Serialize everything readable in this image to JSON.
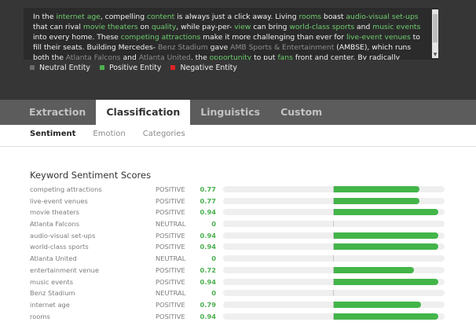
{
  "input_text": {
    "segments": [
      {
        "t": "In the ",
        "c": "plain"
      },
      {
        "t": "internet age",
        "c": "pos"
      },
      {
        "t": ", compelling ",
        "c": "plain"
      },
      {
        "t": "content",
        "c": "pos"
      },
      {
        "t": " is always just a click away. Living ",
        "c": "plain"
      },
      {
        "t": "rooms",
        "c": "pos"
      },
      {
        "t": " boast ",
        "c": "plain"
      },
      {
        "t": "audio-visual set-ups",
        "c": "pos"
      },
      {
        "t": " that can rival ",
        "c": "plain"
      },
      {
        "t": "movie theaters",
        "c": "pos"
      },
      {
        "t": " on ",
        "c": "plain"
      },
      {
        "t": "quality",
        "c": "pos"
      },
      {
        "t": ", while pay-per- ",
        "c": "plain"
      },
      {
        "t": "view",
        "c": "pos"
      },
      {
        "t": " can bring ",
        "c": "plain"
      },
      {
        "t": "world-class sports",
        "c": "pos"
      },
      {
        "t": " and ",
        "c": "plain"
      },
      {
        "t": "music events",
        "c": "pos"
      },
      {
        "t": " into every home. These ",
        "c": "plain"
      },
      {
        "t": "competing attractions",
        "c": "pos"
      },
      {
        "t": " make it more challenging than ever for ",
        "c": "plain"
      },
      {
        "t": "live-event venues",
        "c": "pos"
      },
      {
        "t": " to fill their seats. Building Mercedes- ",
        "c": "plain"
      },
      {
        "t": "Benz Stadium",
        "c": "neu"
      },
      {
        "t": " gave ",
        "c": "plain"
      },
      {
        "t": "AMB Sports & Entertainment",
        "c": "neu"
      },
      {
        "t": " (AMBSE), which runs both the ",
        "c": "plain"
      },
      {
        "t": "Atlanta Falcons",
        "c": "neu"
      },
      {
        "t": " and ",
        "c": "plain"
      },
      {
        "t": "Atlanta United",
        "c": "neu"
      },
      {
        "t": ", the ",
        "c": "plain"
      },
      {
        "t": "opportunity",
        "c": "pos"
      },
      {
        "t": " to put ",
        "c": "plain"
      },
      {
        "t": "fans",
        "c": "pos"
      },
      {
        "t": " front and center. By radically reimagining what a sports and",
        "c": "plain"
      }
    ]
  },
  "legend": [
    {
      "label": "Neutral Entity",
      "color": "#6a6a6a"
    },
    {
      "label": "Positive Entity",
      "color": "#4caf50"
    },
    {
      "label": "Negative Entity",
      "color": "#e02424"
    }
  ],
  "tabs": [
    {
      "label": "Extraction",
      "active": false
    },
    {
      "label": "Classification",
      "active": true
    },
    {
      "label": "Linguistics",
      "active": false
    },
    {
      "label": "Custom",
      "active": false
    }
  ],
  "subtabs": [
    {
      "label": "Sentiment",
      "active": true
    },
    {
      "label": "Emotion",
      "active": false
    },
    {
      "label": "Categories",
      "active": false
    }
  ],
  "keyword_section": {
    "title": "Keyword Sentiment Scores"
  },
  "keywords": [
    {
      "keyword": "competing attractions",
      "sentiment": "POSITIVE",
      "score": 0.77
    },
    {
      "keyword": "live-event venues",
      "sentiment": "POSITIVE",
      "score": 0.77
    },
    {
      "keyword": "movie theaters",
      "sentiment": "POSITIVE",
      "score": 0.94
    },
    {
      "keyword": "Atlanta Falcons",
      "sentiment": "NEUTRAL",
      "score": 0
    },
    {
      "keyword": "audio-visual set-ups",
      "sentiment": "POSITIVE",
      "score": 0.94
    },
    {
      "keyword": "world-class sports",
      "sentiment": "POSITIVE",
      "score": 0.94
    },
    {
      "keyword": "Atlanta United",
      "sentiment": "NEUTRAL",
      "score": 0
    },
    {
      "keyword": "entertainment venue",
      "sentiment": "POSITIVE",
      "score": 0.72
    },
    {
      "keyword": "music events",
      "sentiment": "POSITIVE",
      "score": 0.94
    },
    {
      "keyword": "Benz Stadium",
      "sentiment": "NEUTRAL",
      "score": 0
    },
    {
      "keyword": "internet age",
      "sentiment": "POSITIVE",
      "score": 0.79
    },
    {
      "keyword": "rooms",
      "sentiment": "POSITIVE",
      "score": 0.94
    }
  ],
  "colors": {
    "positive": "#43b549",
    "neutral_mark": "#c8c8c8",
    "panel": "#363636",
    "tabbar": "#5c5c5c"
  }
}
